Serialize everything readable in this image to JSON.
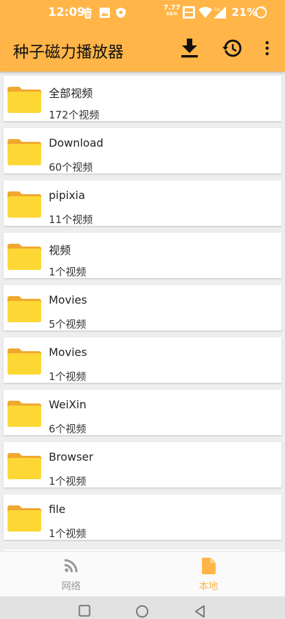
{
  "status_bar": {
    "time": "12:09",
    "net_speed_value": "7.77",
    "net_speed_unit": "KB/S",
    "battery": "21%"
  },
  "app_bar": {
    "title": "种子磁力播放器"
  },
  "folders": [
    {
      "name": "全部视频",
      "count": "172个视频"
    },
    {
      "name": "Download",
      "count": "60个视频"
    },
    {
      "name": "pipixia",
      "count": "11个视频"
    },
    {
      "name": "视频",
      "count": "1个视频"
    },
    {
      "name": "Movies",
      "count": "5个视频"
    },
    {
      "name": "Movies",
      "count": "1个视频"
    },
    {
      "name": "WeiXin",
      "count": "6个视频"
    },
    {
      "name": "Browser",
      "count": "1个视频"
    },
    {
      "name": "file",
      "count": "1个视频"
    }
  ],
  "bottom_nav": {
    "network_label": "网络",
    "local_label": "本地",
    "active_color": "#ffb548",
    "inactive_color": "#999999"
  },
  "colors": {
    "accent": "#ffb548",
    "folder_front": "#fdd835",
    "folder_back": "#f0a830"
  }
}
